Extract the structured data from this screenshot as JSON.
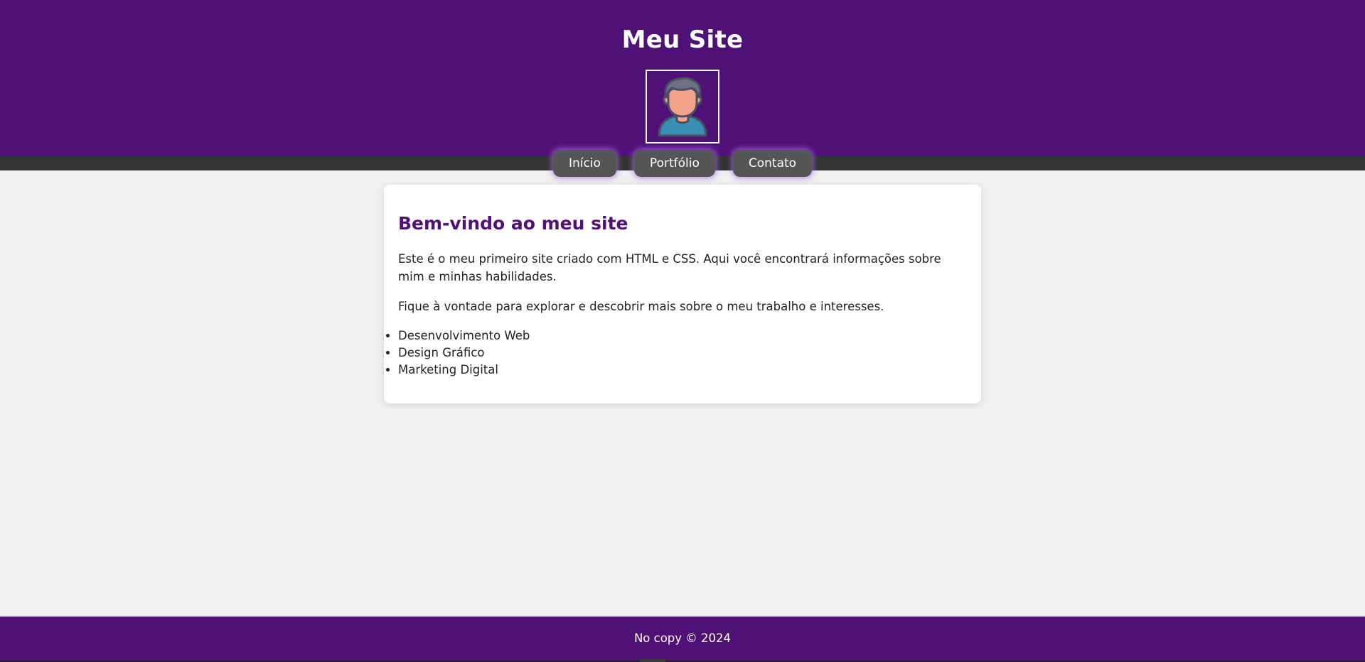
{
  "header": {
    "title": "Meu Site",
    "avatar_icon": "user-avatar-icon"
  },
  "nav": {
    "items": [
      {
        "label": "Início"
      },
      {
        "label": "Portfólio"
      },
      {
        "label": "Contato"
      }
    ]
  },
  "main": {
    "heading": "Bem-vindo ao meu site",
    "paragraphs": [
      "Este é o meu primeiro site criado com HTML e CSS. Aqui você encontrará informações sobre mim e minhas habilidades.",
      "Fique à vontade para explorar e descobrir mais sobre o meu trabalho e interesses."
    ],
    "skills": [
      "Desenvolvimento Web",
      "Design Gráfico",
      "Marketing Digital"
    ]
  },
  "footer": {
    "text": "No copy © 2024"
  },
  "colors": {
    "brand_purple": "#501177",
    "nav_bar": "#333333",
    "nav_button": "#555555",
    "page_background": "#f0f0f0",
    "card_background": "#ffffff"
  }
}
